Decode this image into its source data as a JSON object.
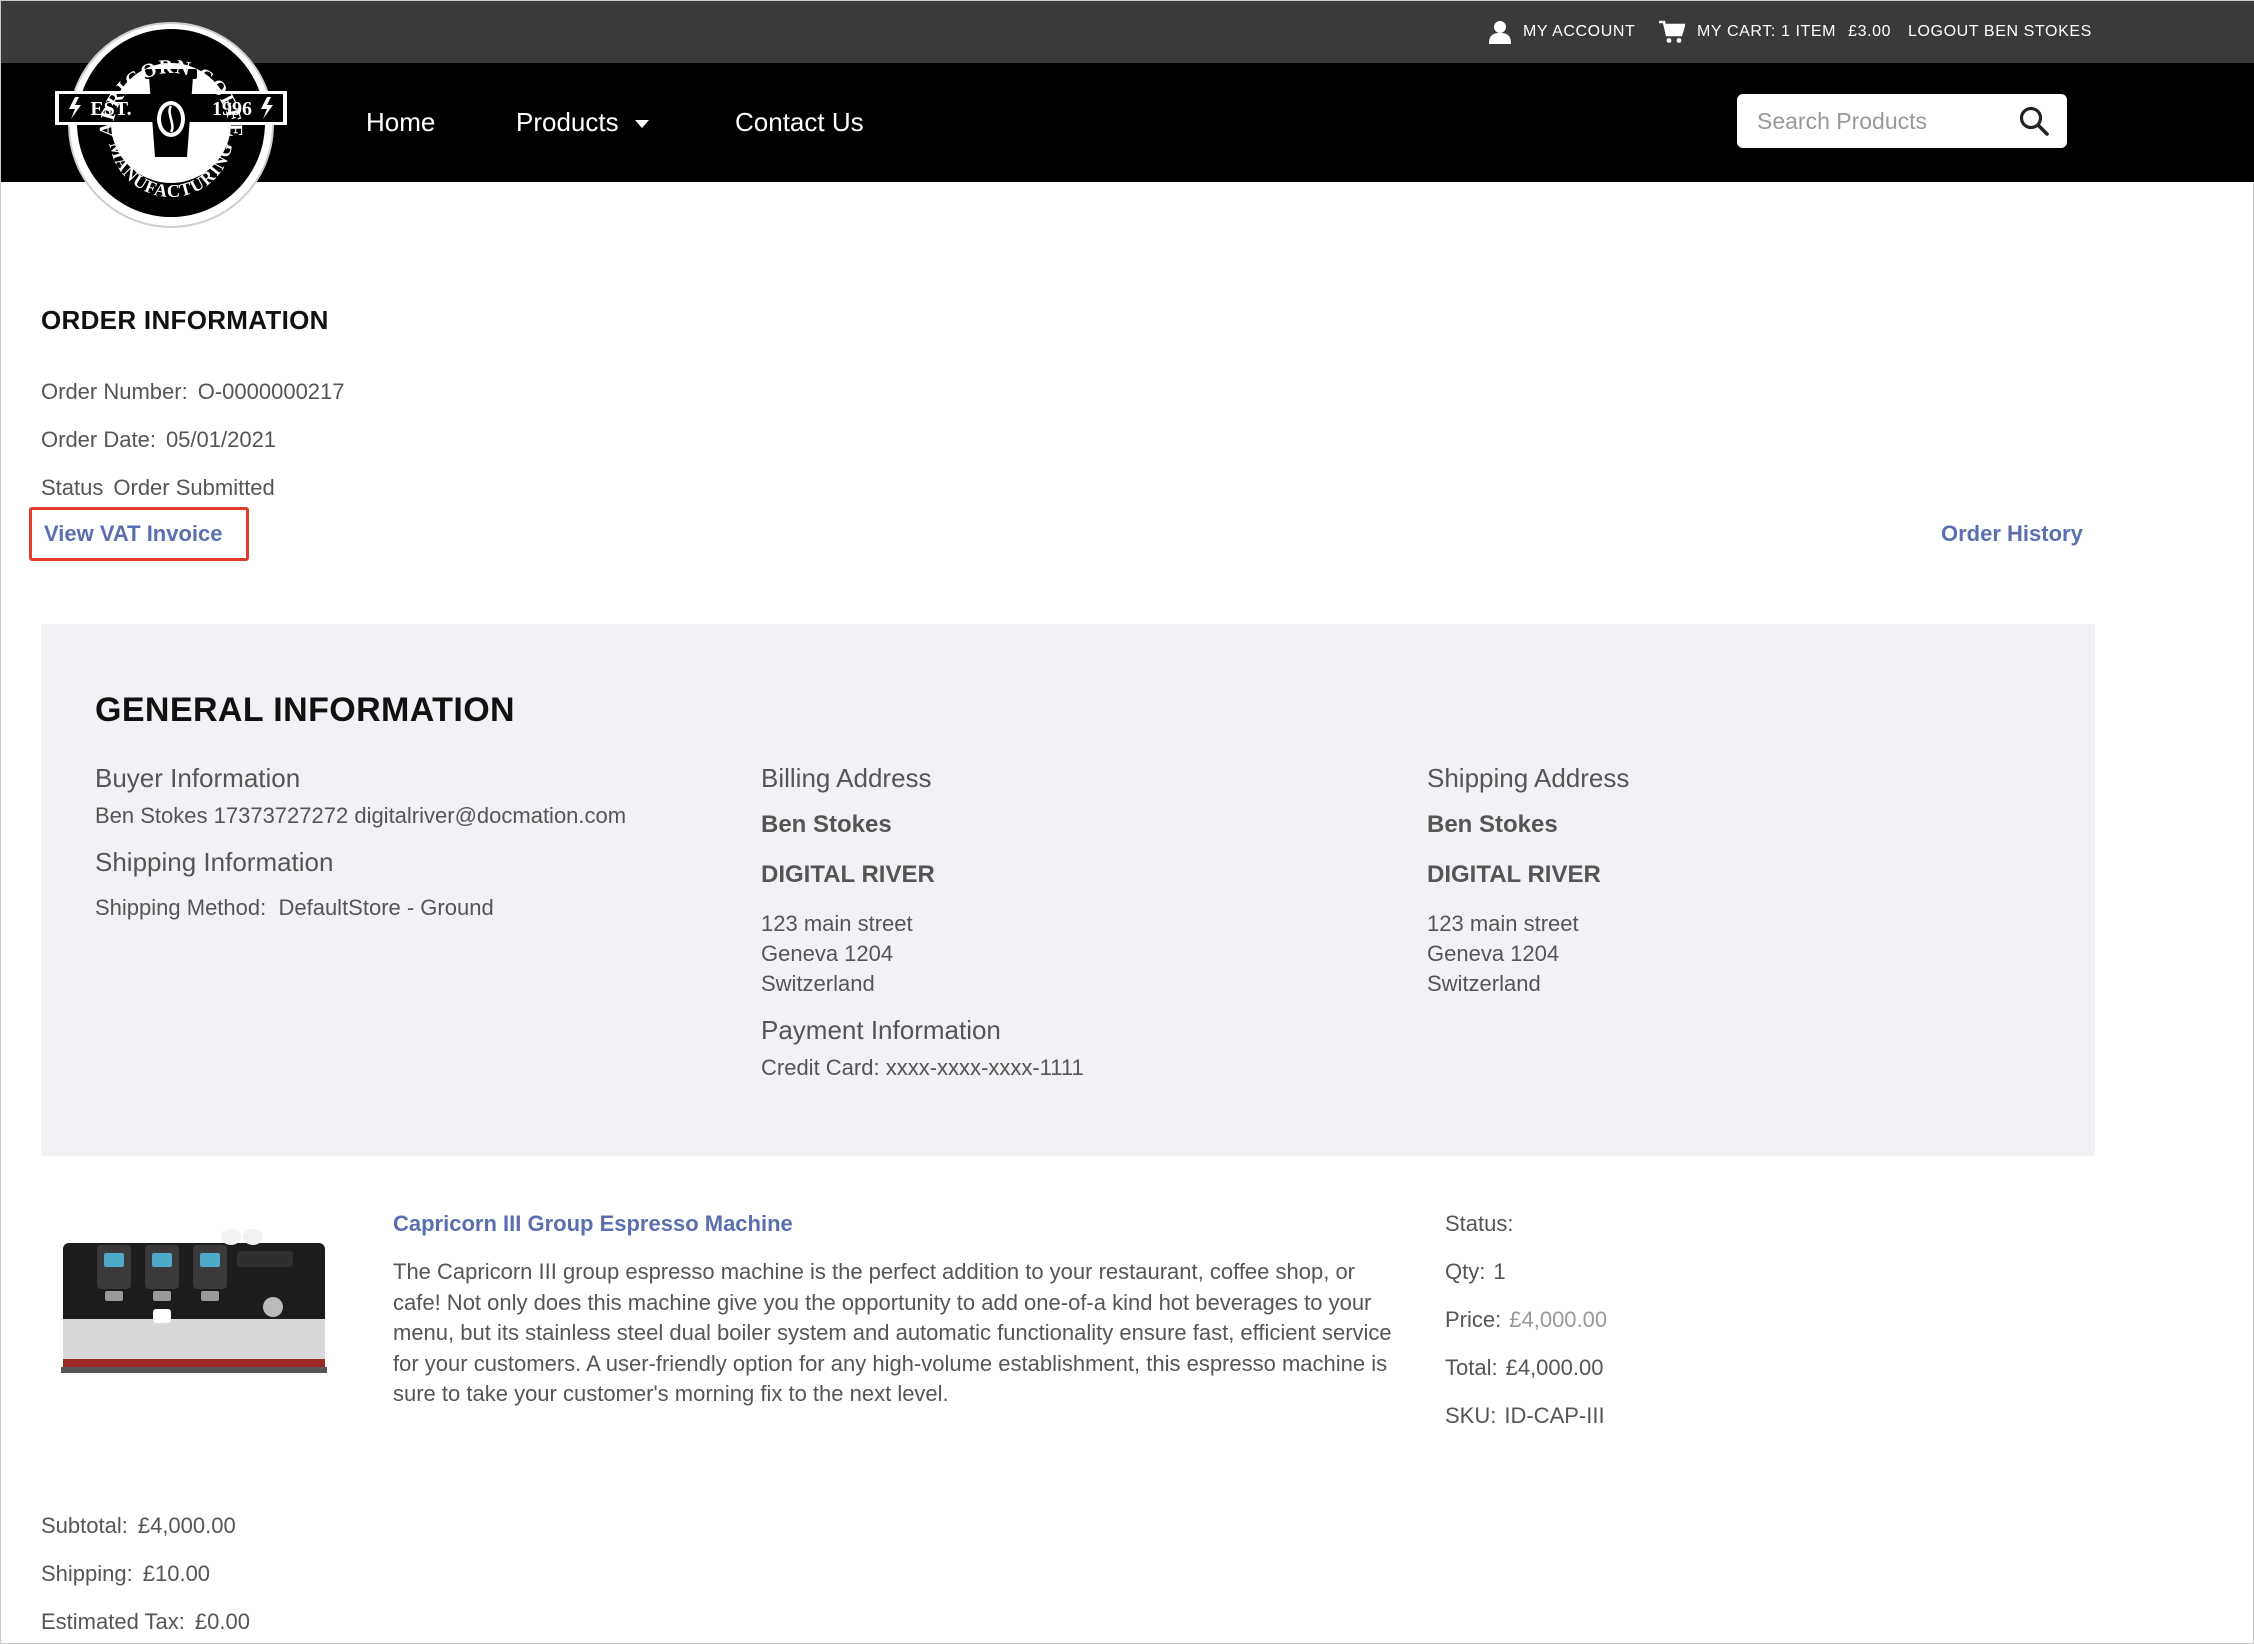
{
  "header": {
    "my_account": "MY ACCOUNT",
    "cart_label": "MY CART: 1 ITEM",
    "cart_total": "£3.00",
    "logout": "LOGOUT BEN STOKES"
  },
  "logo": {
    "top_text": "CAPRICORN COFFEE",
    "bottom_text": "MANUFACTURING",
    "left_text": "EST.",
    "right_text": "1996"
  },
  "nav": {
    "home": "Home",
    "products": "Products",
    "contact": "Contact Us",
    "search_placeholder": "Search Products"
  },
  "order": {
    "heading": "ORDER INFORMATION",
    "number_label": "Order Number:",
    "number_value": "O-0000000217",
    "date_label": "Order Date:",
    "date_value": "05/01/2021",
    "status_label": "Status",
    "status_value": "Order Submitted",
    "vat_link": "View VAT Invoice",
    "history_link": "Order History"
  },
  "general": {
    "heading": "GENERAL INFORMATION",
    "buyer_heading": "Buyer Information",
    "buyer_details": "Ben Stokes 17373727272 digitalriver@docmation.com",
    "shipping_info_heading": "Shipping Information",
    "shipping_method_label": "Shipping Method:",
    "shipping_method_value": "DefaultStore - Ground",
    "billing": {
      "heading": "Billing Address",
      "name": "Ben  Stokes",
      "company": "DIGITAL RIVER",
      "street": "123 main street",
      "city": "Geneva  1204",
      "country": "Switzerland"
    },
    "payment_heading": "Payment Information",
    "payment_value": "Credit Card: xxxx-xxxx-xxxx-1111",
    "shipping": {
      "heading": "Shipping Address",
      "name": "Ben  Stokes",
      "company": "DIGITAL RIVER",
      "street": "123 main street",
      "city": "Geneva  1204",
      "country": "Switzerland"
    }
  },
  "product": {
    "title": "Capricorn III Group Espresso Machine",
    "description": "The Capricorn III group espresso machine is the perfect addition to your restaurant, coffee shop, or cafe! Not only does this machine give you the opportunity to add one-of-a kind hot beverages to your menu, but its stainless steel dual boiler system and automatic functionality ensure fast, efficient service for your customers. A user-friendly option for any high-volume establishment, this espresso machine is sure to take your customer's morning fix to the next level.",
    "status_label": "Status:",
    "qty_label": "Qty:",
    "qty_value": "1",
    "price_label": "Price:",
    "price_value": "£4,000.00",
    "total_label": "Total:",
    "total_value": "£4,000.00",
    "sku_label": "SKU:",
    "sku_value": "ID-CAP-III"
  },
  "totals": {
    "subtotal_label": "Subtotal:",
    "subtotal_value": "£4,000.00",
    "shipping_label": "Shipping:",
    "shipping_value": "£10.00",
    "tax_label": "Estimated Tax:",
    "tax_value": "£0.00"
  },
  "colors": {
    "topbar": "#3a3a3c",
    "navbar": "#000000",
    "link": "#5b6fb0",
    "highlight": "#e33b2e",
    "panel": "#f1f2f5"
  }
}
